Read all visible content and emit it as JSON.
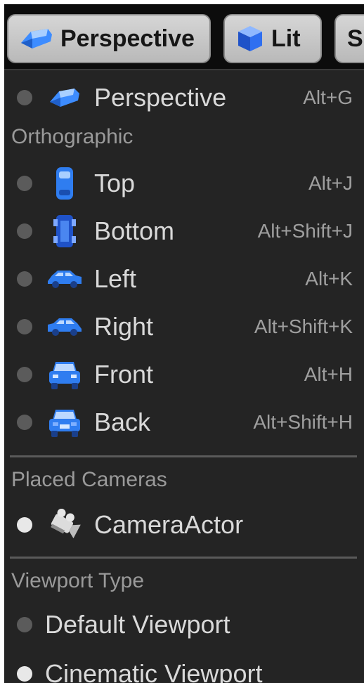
{
  "toolbar": {
    "perspective_label": "Perspective",
    "lit_label": "Lit",
    "third_label": "S"
  },
  "menu": {
    "perspective": {
      "label": "Perspective",
      "shortcut": "Alt+G",
      "icon": "perspective-icon"
    },
    "orthographic_header": "Orthographic",
    "views": [
      {
        "label": "Top",
        "shortcut": "Alt+J",
        "icon": "top-view-icon"
      },
      {
        "label": "Bottom",
        "shortcut": "Alt+Shift+J",
        "icon": "bottom-view-icon"
      },
      {
        "label": "Left",
        "shortcut": "Alt+K",
        "icon": "left-view-icon"
      },
      {
        "label": "Right",
        "shortcut": "Alt+Shift+K",
        "icon": "right-view-icon"
      },
      {
        "label": "Front",
        "shortcut": "Alt+H",
        "icon": "front-view-icon"
      },
      {
        "label": "Back",
        "shortcut": "Alt+Shift+H",
        "icon": "back-view-icon"
      }
    ],
    "placed_cameras_header": "Placed Cameras",
    "camera": {
      "label": "CameraActor",
      "icon": "camera-icon",
      "selected": true
    },
    "viewport_type_header": "Viewport Type",
    "viewport_types": [
      {
        "label": "Default Viewport",
        "selected": false
      },
      {
        "label": "Cinematic Viewport",
        "selected": true
      }
    ]
  },
  "colors": {
    "menu_bg": "#242424",
    "text": "#d9d9d9",
    "shortcut": "#9f9f9f",
    "icon_blue": "#2f7df0"
  }
}
